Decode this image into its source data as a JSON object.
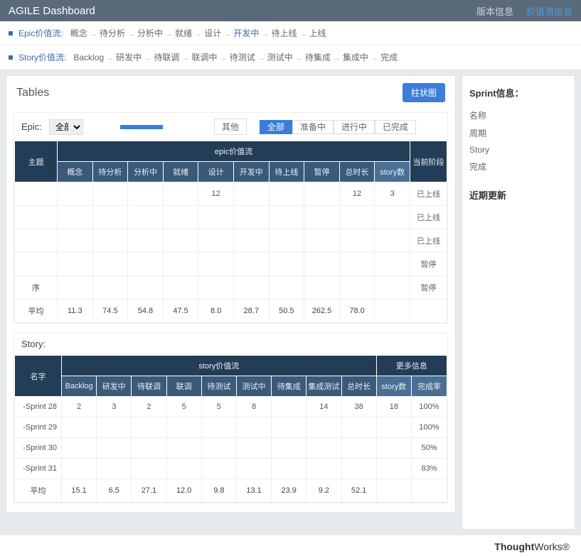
{
  "header": {
    "title": "AGILE Dashboard",
    "links": {
      "version": "版本信息",
      "valueflow": "价值流信息"
    }
  },
  "epic_flow": {
    "label": "Epic价值流:",
    "steps": [
      "概念",
      "待分析",
      "分析中",
      "就绪",
      "设计",
      "开发中",
      "待上线",
      "上线"
    ],
    "active": "开发中"
  },
  "story_flow": {
    "label": "Story价值流:",
    "steps": [
      "Backlog",
      "研发中",
      "待联调",
      "联调中",
      "待测试",
      "测试中",
      "待集成",
      "集成中",
      "完成"
    ]
  },
  "tables_title": "Tables",
  "chart_button": "柱状图",
  "epic": {
    "label": "Epic:",
    "select": "全部",
    "other": "其他",
    "tabs": [
      "全部",
      "准备中",
      "进行中",
      "已完成"
    ],
    "active_tab": "全部",
    "head": {
      "theme": "主题",
      "flow": "epic价值流",
      "phase": "当前阶段",
      "cols": [
        "概念",
        "待分析",
        "分析中",
        "就绪",
        "设计",
        "开发中",
        "待上线",
        "暂停",
        "总时长",
        "story数"
      ]
    },
    "rows": [
      {
        "name": "",
        "vals": [
          "",
          "",
          "",
          "",
          "12",
          "",
          "",
          "",
          "12",
          "3"
        ],
        "state": "已上线"
      },
      {
        "name": "",
        "vals": [
          "",
          "",
          "",
          "",
          "",
          "",
          "",
          "",
          "",
          ""
        ],
        "state": "已上线"
      },
      {
        "name": "",
        "vals": [
          "",
          "",
          "",
          "",
          "",
          "",
          "",
          "",
          "",
          ""
        ],
        "state": "已上线"
      },
      {
        "name": "",
        "vals": [
          "",
          "",
          "",
          "",
          "",
          "",
          "",
          "",
          "",
          ""
        ],
        "state": "暂停"
      },
      {
        "name": "序",
        "vals": [
          "",
          "",
          "",
          "",
          "",
          "",
          "",
          "",
          "",
          ""
        ],
        "state": "暂停"
      }
    ],
    "avg_label": "平均",
    "avg": [
      "11.3",
      "74.5",
      "54.8",
      "47.5",
      "8.0",
      "28.7",
      "50.5",
      "262.5",
      "78.0",
      ""
    ]
  },
  "story": {
    "label": "Story:",
    "head": {
      "name": "名字",
      "flow": "story价值流",
      "more": "更多信息",
      "cols": [
        "Backlog",
        "研发中",
        "待联调",
        "联调",
        "待测试",
        "测试中",
        "待集成",
        "集成测试",
        "总时长",
        "story数",
        "完成率"
      ]
    },
    "rows": [
      {
        "name": "-Sprint 28",
        "vals": [
          "2",
          "3",
          "2",
          "5",
          "5",
          "8",
          "",
          "14",
          "38",
          "18",
          "100%"
        ]
      },
      {
        "name": "-Sprint 29",
        "vals": [
          "",
          "",
          "",
          "",
          "",
          "",
          "",
          "",
          "",
          "",
          "100%"
        ]
      },
      {
        "name": "-Sprint 30",
        "vals": [
          "",
          "",
          "",
          "",
          "",
          "",
          "",
          "",
          "",
          "",
          "50%"
        ]
      },
      {
        "name": "-Sprint 31",
        "vals": [
          "",
          "",
          "",
          "",
          "",
          "",
          "",
          "",
          "",
          "",
          "83%"
        ]
      }
    ],
    "avg_label": "平均",
    "avg": [
      "15.1",
      "6.5",
      "27.1",
      "12.0",
      "9.8",
      "13.1",
      "23.9",
      "9.2",
      "52.1",
      "",
      ""
    ]
  },
  "sidebar": {
    "sprint_title": "Sprint信息：",
    "items": [
      "名称",
      "周期",
      "Story",
      "完成"
    ],
    "recent_title": "近期更新"
  },
  "footer": {
    "brand1": "Thought",
    "brand2": "Works"
  }
}
